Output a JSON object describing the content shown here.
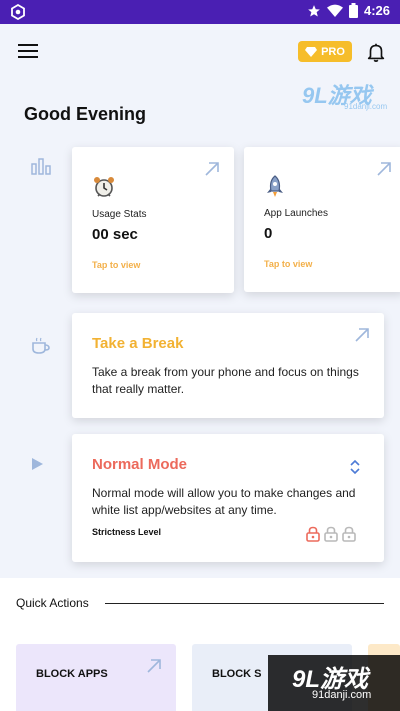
{
  "status_bar": {
    "time": "4:26"
  },
  "header": {
    "pro_label": "PRO"
  },
  "watermark": {
    "brand": "9L游戏",
    "domain": "91danji.com"
  },
  "greeting": "Good Evening",
  "stats": [
    {
      "label": "Usage Stats",
      "value": "00 sec",
      "link": "Tap to view",
      "icon": "alarm-clock-icon"
    },
    {
      "label": "App Launches",
      "value": "0",
      "link": "Tap to view",
      "icon": "rocket-icon"
    }
  ],
  "take_break": {
    "title": "Take a Break",
    "body": "Take a break from your phone and focus on things that really matter."
  },
  "normal_mode": {
    "title": "Normal Mode",
    "body": "Normal mode will allow you to make changes and white list app/websites at any time.",
    "strictness_label": "Strictness Level",
    "strictness_level": 1,
    "strictness_max": 3
  },
  "quick_actions": {
    "label": "Quick Actions",
    "items": [
      {
        "label": "BLOCK APPS"
      },
      {
        "label": "BLOCK S"
      }
    ]
  },
  "colors": {
    "status_bar": "#4a1fb3",
    "accent_pro": "#f6bd2a",
    "tap_link": "#f3b04a",
    "break_title": "#f2b233",
    "mode_title": "#ec6a5c",
    "side_icon": "#9fb7dc"
  }
}
